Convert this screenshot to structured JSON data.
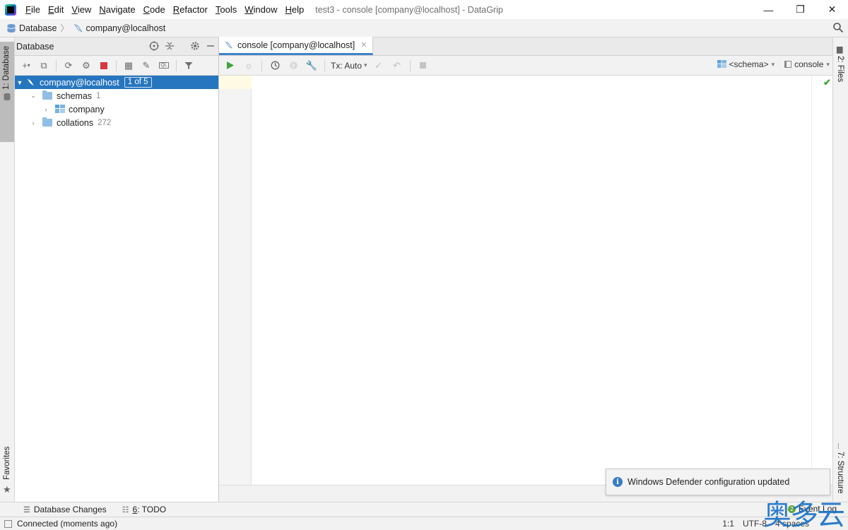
{
  "titlebar": {
    "menu": [
      {
        "pre": "",
        "mn": "F",
        "post": "ile"
      },
      {
        "pre": "",
        "mn": "E",
        "post": "dit"
      },
      {
        "pre": "",
        "mn": "V",
        "post": "iew"
      },
      {
        "pre": "",
        "mn": "N",
        "post": "avigate"
      },
      {
        "pre": "",
        "mn": "C",
        "post": "ode"
      },
      {
        "pre": "",
        "mn": "R",
        "post": "efactor"
      },
      {
        "pre": "",
        "mn": "T",
        "post": "ools"
      },
      {
        "pre": "",
        "mn": "W",
        "post": "indow"
      },
      {
        "pre": "",
        "mn": "H",
        "post": "elp"
      }
    ],
    "window_title": "test3 - console [company@localhost] - DataGrip",
    "minimize": "—",
    "maximize": "❐",
    "close": "✕"
  },
  "navbar": {
    "crumbs": [
      "Database",
      "company@localhost"
    ]
  },
  "left_strip": {
    "database_tab": "1: Database",
    "favorites_tab": "Favorites"
  },
  "right_strip": {
    "files_tab": "2: Files",
    "structure_tab": "7: Structure"
  },
  "db_panel": {
    "title": "Database",
    "tree": {
      "root_label": "company@localhost",
      "root_badge": "1 of 5",
      "schemas_label": "schemas",
      "schemas_count": "1",
      "company_label": "company",
      "collations_label": "collations",
      "collations_count": "272"
    }
  },
  "editor": {
    "tab_label": "console [company@localhost]",
    "tx_label": "Tx: Auto",
    "schema_selector": "<schema>",
    "console_selector": "console"
  },
  "notification": {
    "text": "Windows Defender configuration updated"
  },
  "toolwindows": {
    "db_changes": "Database Changes",
    "todo_mn": "6",
    "todo_label": ": TODO",
    "event_log": "Event Log",
    "event_badge": "2"
  },
  "status": {
    "left": "Connected (moments ago)",
    "position": "1:1",
    "encoding": "UTF-8",
    "indent": "4 spaces"
  },
  "watermark": "奥多云",
  "colors": {
    "selection": "#2675bf",
    "tab_underline": "#4083c9",
    "folder": "#8fbfe6",
    "run_green": "#3fa33a",
    "stop_red": "#d9363e"
  }
}
